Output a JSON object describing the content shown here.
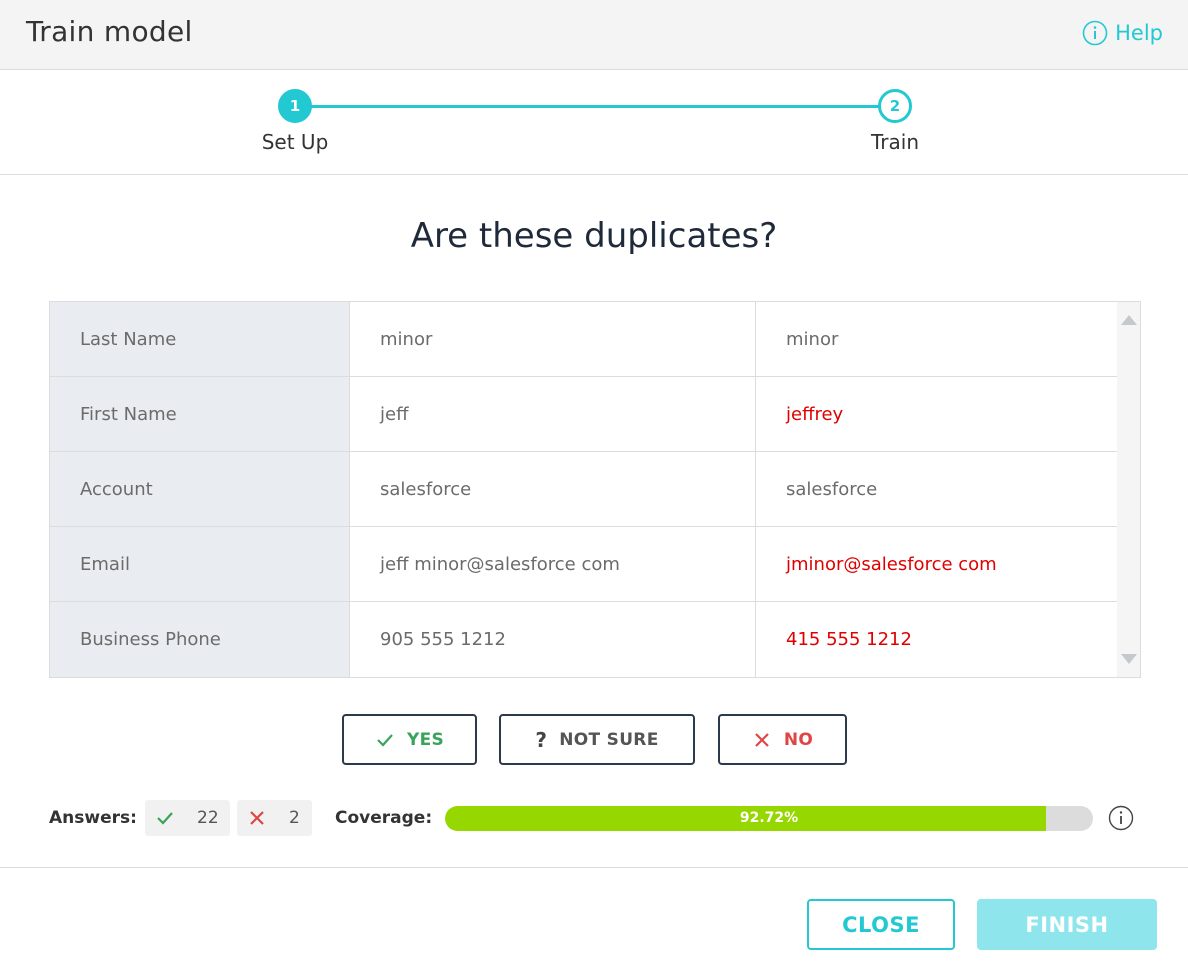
{
  "header": {
    "title": "Train model",
    "help_label": "Help"
  },
  "stepper": {
    "steps": [
      {
        "number": "1",
        "label": "Set Up",
        "state": "complete"
      },
      {
        "number": "2",
        "label": "Train",
        "state": "current"
      }
    ]
  },
  "question": "Are these duplicates?",
  "comparison": {
    "rows": [
      {
        "label": "Last Name",
        "value_a": "minor",
        "value_b": "minor",
        "differs": false
      },
      {
        "label": "First Name",
        "value_a": "jeff",
        "value_b": "jeffrey",
        "differs": true
      },
      {
        "label": "Account",
        "value_a": "salesforce",
        "value_b": "salesforce",
        "differs": false
      },
      {
        "label": "Email",
        "value_a": "jeff minor@salesforce com",
        "value_b": "jminor@salesforce com",
        "differs": true
      },
      {
        "label": "Business Phone",
        "value_a": "905  555 1212",
        "value_b": "415  555 1212",
        "differs": true
      }
    ]
  },
  "answer_buttons": {
    "yes": "YES",
    "not_sure": "NOT SURE",
    "no": "NO"
  },
  "stats": {
    "answers_label": "Answers:",
    "yes_count": "22",
    "no_count": "2",
    "coverage_label": "Coverage:",
    "coverage_text": "92.72%",
    "coverage_fraction": 0.9272
  },
  "footer": {
    "close_label": "CLOSE",
    "finish_label": "FINISH"
  },
  "colors": {
    "accent": "#22c9d3",
    "diff": "#e00000",
    "yes": "#3aa35b",
    "no": "#e04545",
    "progress": "#97d700"
  }
}
